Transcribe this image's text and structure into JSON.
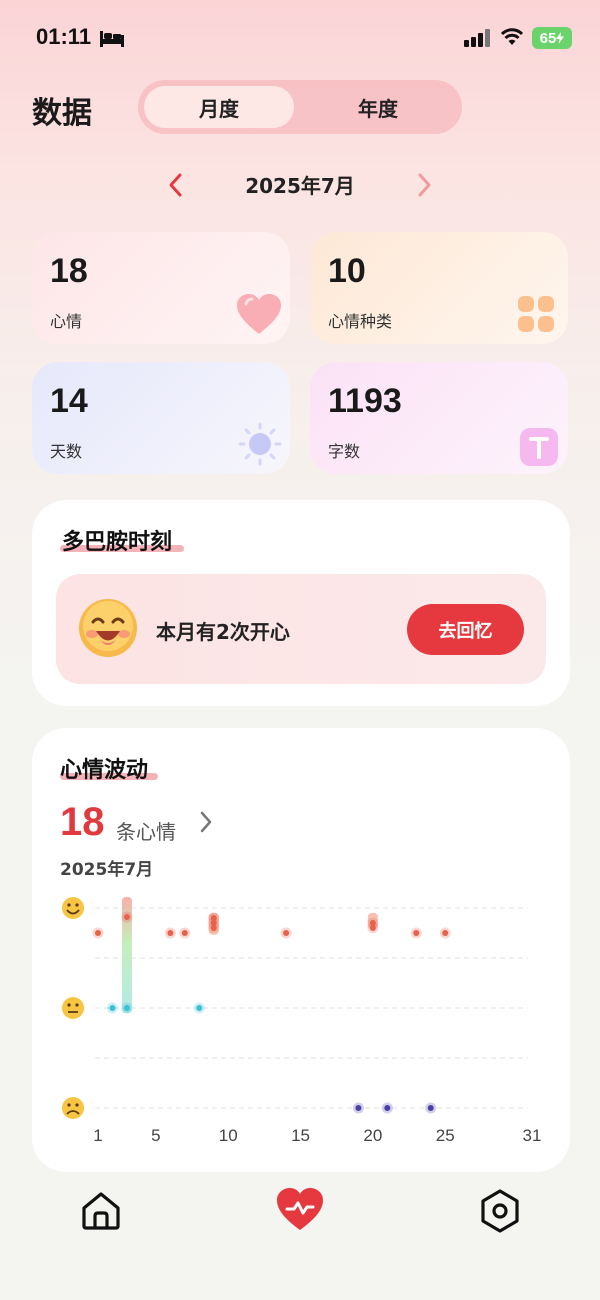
{
  "status_bar": {
    "time": "01:11",
    "battery": "65"
  },
  "header": {
    "title": "数据",
    "tabs": [
      "月度",
      "年度"
    ],
    "active_tab": "月度"
  },
  "period": {
    "label": "2025年7月"
  },
  "stats": [
    {
      "value": "18",
      "label": "心情",
      "icon": "heart-icon"
    },
    {
      "value": "10",
      "label": "心情种类",
      "icon": "grid-icon"
    },
    {
      "value": "14",
      "label": "天数",
      "icon": "sun-icon"
    },
    {
      "value": "1193",
      "label": "字数",
      "icon": "text-icon"
    }
  ],
  "dopamine": {
    "title": "多巴胺时刻",
    "message": "本月有2次开心",
    "button": "去回忆",
    "icon": "laughing-face-icon"
  },
  "mood_wave": {
    "title": "心情波动",
    "count": "18",
    "count_unit": "条心情",
    "month": "2025年7月"
  },
  "colors": {
    "accent": "#e6393f",
    "happy": "#e8614a",
    "neutral": "#3dbfd6",
    "sad": "#4a3fa8"
  },
  "chart_data": {
    "type": "scatter",
    "x_ticks": [
      1,
      5,
      10,
      15,
      20,
      25,
      31
    ],
    "xlim": [
      1,
      31
    ],
    "y_levels": [
      "sad",
      "neutral",
      "happy"
    ],
    "y_icons": [
      "frown-face-icon",
      "neutral-face-icon",
      "smile-face-icon"
    ],
    "points": [
      {
        "day": 1,
        "level": "happy"
      },
      {
        "day": 2,
        "level": "neutral"
      },
      {
        "day": 3,
        "level": "neutral"
      },
      {
        "day": 3,
        "level": "happy"
      },
      {
        "day": 6,
        "level": "happy"
      },
      {
        "day": 7,
        "level": "happy"
      },
      {
        "day": 8,
        "level": "neutral"
      },
      {
        "day": 9,
        "level": "happy"
      },
      {
        "day": 9,
        "level": "happy"
      },
      {
        "day": 9,
        "level": "happy"
      },
      {
        "day": 14,
        "level": "happy"
      },
      {
        "day": 19,
        "level": "sad"
      },
      {
        "day": 20,
        "level": "happy"
      },
      {
        "day": 20,
        "level": "happy"
      },
      {
        "day": 21,
        "level": "sad"
      },
      {
        "day": 23,
        "level": "happy"
      },
      {
        "day": 24,
        "level": "sad"
      },
      {
        "day": 25,
        "level": "happy"
      }
    ]
  },
  "nav": {
    "items": [
      "home",
      "mood-data",
      "settings"
    ],
    "active": "mood-data"
  }
}
